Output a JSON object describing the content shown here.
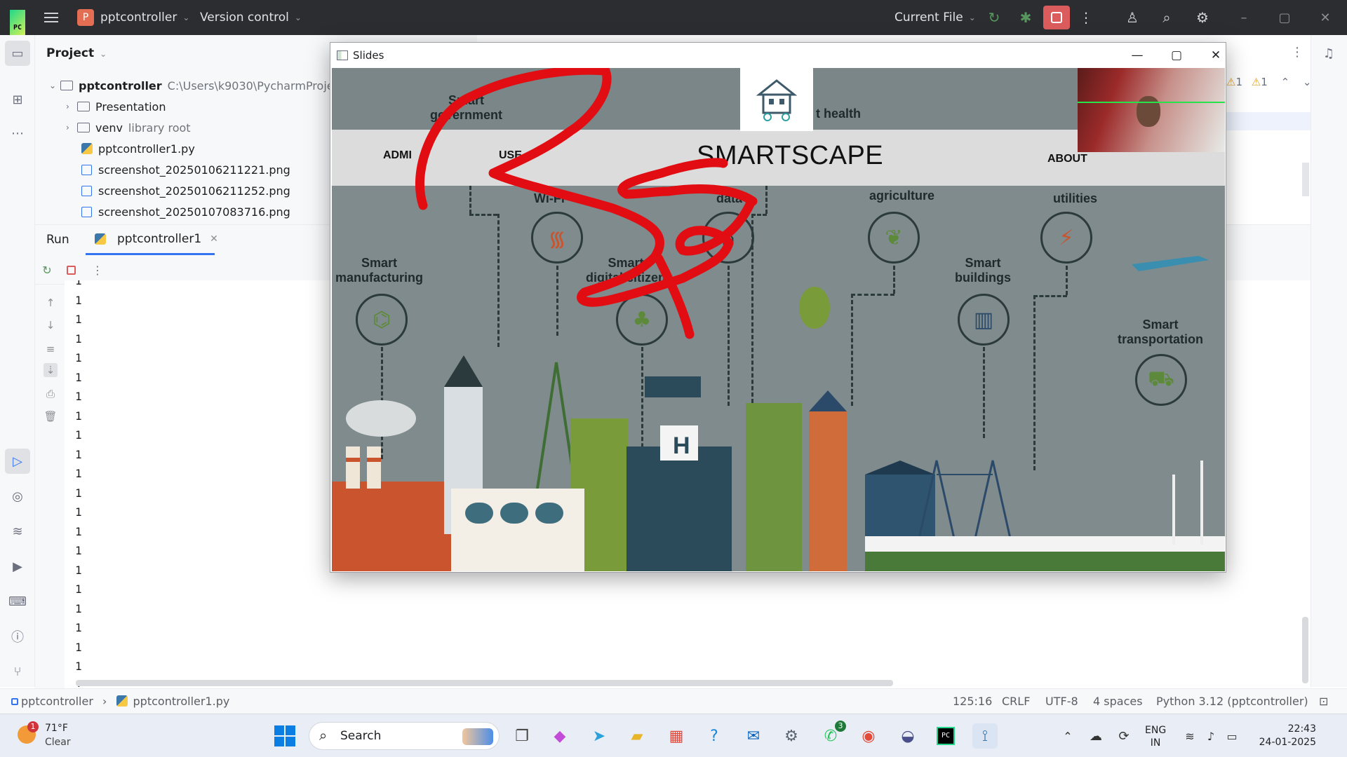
{
  "ide": {
    "project_name": "pptcontroller",
    "project_initial": "P",
    "vcs": "Version control",
    "run_config": "Current File"
  },
  "project_panel": {
    "title": "Project",
    "root": {
      "name": "pptcontroller",
      "path": "C:\\Users\\k9030\\PycharmProje"
    },
    "items": [
      {
        "name": "Presentation",
        "type": "folder",
        "note": ""
      },
      {
        "name": "venv",
        "type": "folder",
        "note": "library root"
      },
      {
        "name": "pptcontroller1.py",
        "type": "python",
        "note": ""
      },
      {
        "name": "screenshot_20250106211221.png",
        "type": "image",
        "note": ""
      },
      {
        "name": "screenshot_20250106211252.png",
        "type": "image",
        "note": ""
      },
      {
        "name": "screenshot_20250107083716.png",
        "type": "image",
        "note": ""
      }
    ]
  },
  "editor_badges": {
    "warnings": "1",
    "weak_warnings": "1"
  },
  "run_panel": {
    "title": "Run",
    "tab": "pptcontroller1",
    "output": [
      "1",
      "1",
      "1",
      "1",
      "1",
      "1",
      "1",
      "1",
      "1",
      "1",
      "1",
      "1",
      "1",
      "1",
      "1",
      "1",
      "1",
      "1",
      "1",
      "1",
      "1",
      "1"
    ]
  },
  "statusbar": {
    "breadcrumb_project": "pptcontroller",
    "breadcrumb_file": "pptcontroller1.py",
    "position": "125:16",
    "line_sep": "CRLF",
    "encoding": "UTF-8",
    "indent": "4 spaces",
    "interpreter": "Python 3.12 (pptcontroller)"
  },
  "slides_window": {
    "title": "Slides",
    "slide": {
      "brand": "SMARTSCAPE",
      "nav": {
        "admin": "ADMI",
        "user": "USE",
        "about": "ABOUT"
      },
      "top_labels": {
        "government": "Smart\ngovernment",
        "health": "t health"
      },
      "categories": {
        "wifi": "Wi-Fi",
        "data": "data",
        "agriculture": "agriculture",
        "utilities": "utilities",
        "manufacturing": "Smart\nmanufacturing",
        "digital_citizen": "Smart\ndigital citizen",
        "buildings": "Smart\nbuildings",
        "transportation": "Smart\ntransportation"
      }
    }
  },
  "taskbar": {
    "weather_temp": "71°F",
    "weather_desc": "Clear",
    "weather_badge": "1",
    "search": "Search",
    "whatsapp_badge": "3",
    "lang_top": "ENG",
    "lang_bottom": "IN",
    "time": "22:43",
    "date": "24-01-2025"
  },
  "colors": {
    "ide_topbar": "#2b2d30",
    "accent": "#3574f0",
    "stop": "#db5c5c",
    "annotation_red": "#e10d12"
  }
}
